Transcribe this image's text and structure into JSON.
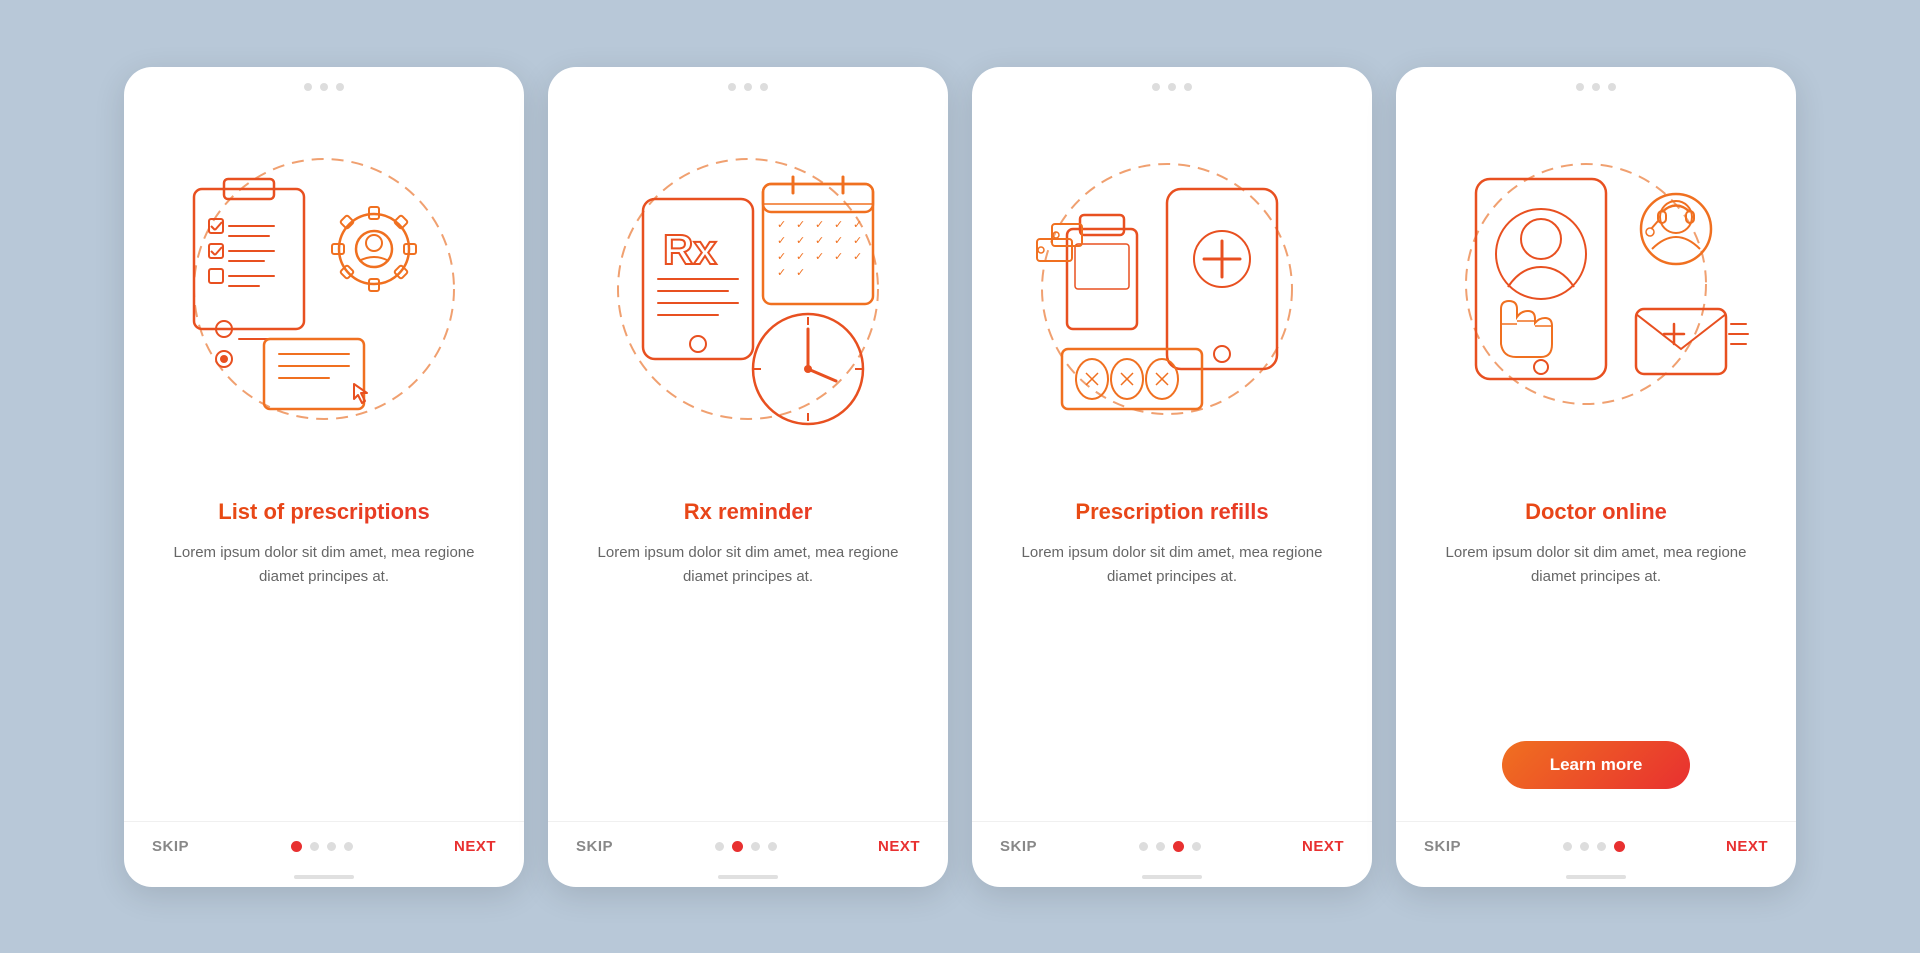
{
  "cards": [
    {
      "id": "prescriptions",
      "title": "List of prescriptions",
      "description": "Lorem ipsum dolor sit dim amet, mea regione diamet principes at.",
      "skip_label": "SKIP",
      "next_label": "NEXT",
      "dots": [
        true,
        false,
        false,
        false
      ],
      "active_dot": 0,
      "show_learn_more": false
    },
    {
      "id": "reminder",
      "title": "Rx reminder",
      "description": "Lorem ipsum dolor sit dim amet, mea regione diamet principes at.",
      "skip_label": "SKIP",
      "next_label": "NEXT",
      "dots": [
        false,
        true,
        false,
        false
      ],
      "active_dot": 1,
      "show_learn_more": false
    },
    {
      "id": "refills",
      "title": "Prescription refills",
      "description": "Lorem ipsum dolor sit dim amet, mea regione diamet principes at.",
      "skip_label": "SKIP",
      "next_label": "NEXT",
      "dots": [
        false,
        false,
        true,
        false
      ],
      "active_dot": 2,
      "show_learn_more": false
    },
    {
      "id": "doctor",
      "title": "Doctor online",
      "description": "Lorem ipsum dolor sit dim amet, mea regione diamet principes at.",
      "skip_label": "SKIP",
      "next_label": "NEXT",
      "dots": [
        false,
        false,
        false,
        true
      ],
      "active_dot": 3,
      "show_learn_more": true,
      "learn_more_label": "Learn more"
    }
  ],
  "colors": {
    "accent_red": "#e83030",
    "accent_orange": "#f07020",
    "icon_stroke": "#e83030",
    "icon_orange": "#f07020"
  }
}
